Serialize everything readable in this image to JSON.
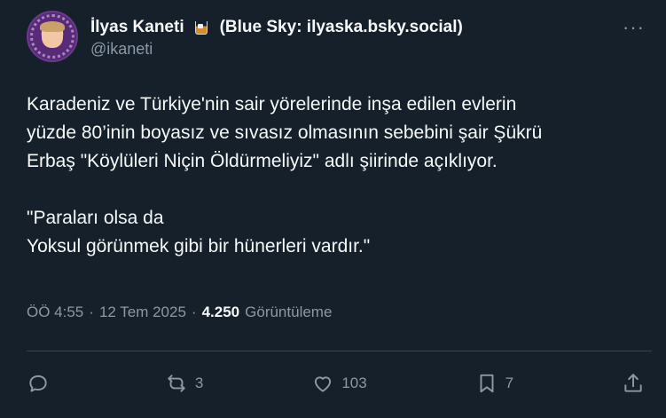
{
  "author": {
    "display_name": "İlyas Kaneti",
    "emoji": "tumbler-glass-icon",
    "bio_suffix": "(Blue Sky: ilyaska.bsky.social)",
    "handle": "@ikaneti"
  },
  "tweet": {
    "text": "Karadeniz ve Türkiye'nin sair yörelerinde inşa edilen evlerin\nyüzde 80’inin boyasız ve sıvasız olmasının sebebini şair Şükrü\nErbaş \"Köylüleri Niçin Öldürmeliyiz\" adlı şiirinde açıklıyor.\n\n\"Paraları olsa da\nYoksul görünmek gibi bir hünerleri vardır.\""
  },
  "meta": {
    "time": "ÖÖ 4:55",
    "sep1": "·",
    "date": "12 Tem 2025",
    "sep2": "·",
    "views_count": "4.250",
    "views_label": "Görüntüleme"
  },
  "actions": {
    "reply_count": "",
    "repost_count": "3",
    "like_count": "103",
    "bookmark_count": "7",
    "share_count": ""
  },
  "colors": {
    "background": "#15202b",
    "text": "#f7f9f9",
    "muted": "#8b98a5",
    "divider": "#38444d"
  }
}
